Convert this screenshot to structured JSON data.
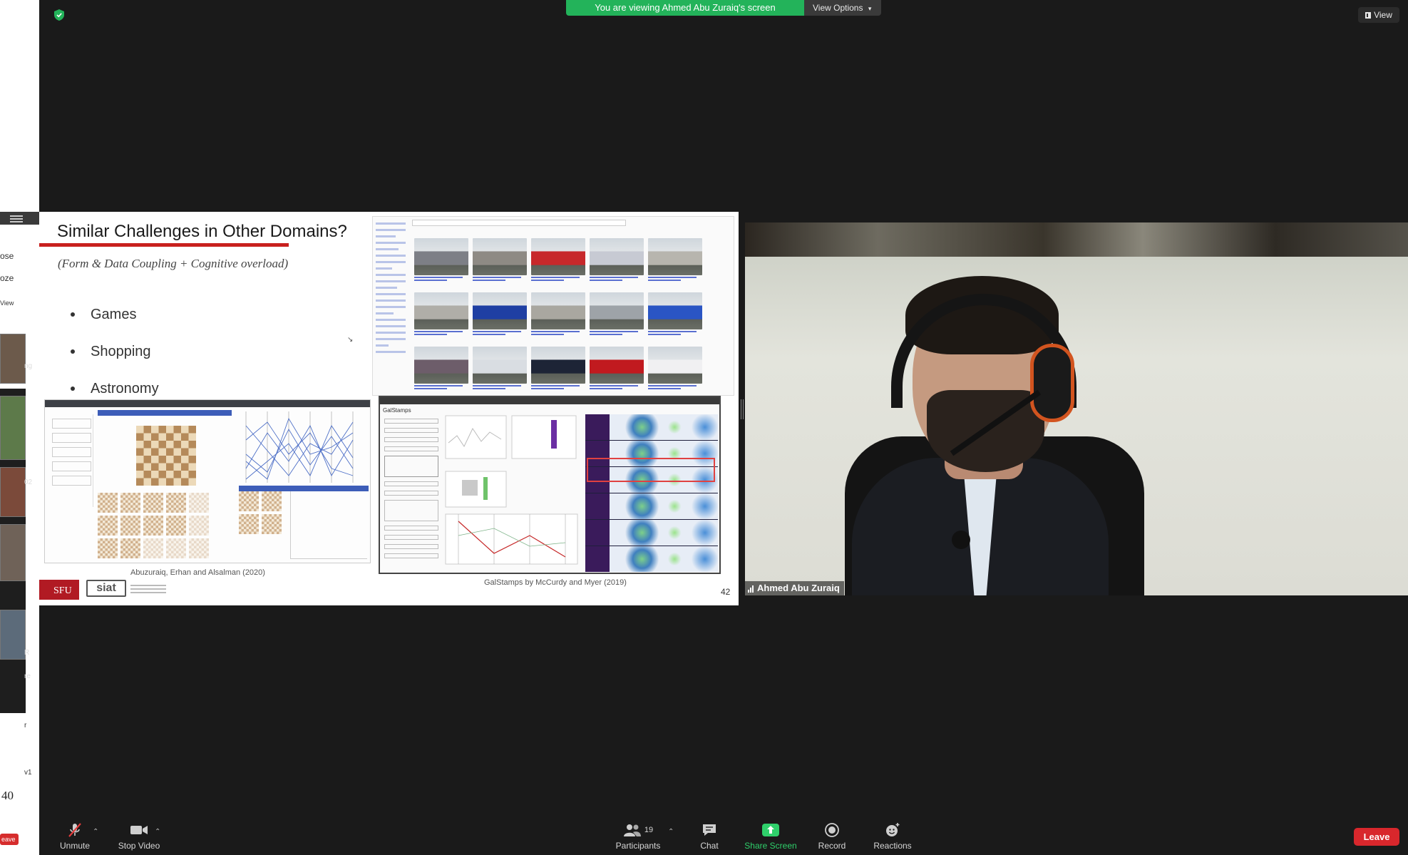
{
  "window": {
    "banner_text": "You are viewing Ahmed Abu Zuraiq's screen",
    "view_options_label": "View Options",
    "view_label": "View"
  },
  "left_strip": {
    "snippets": [
      "ose",
      "oze",
      "View",
      "ng",
      "02",
      "R",
      "re",
      "r",
      "v1"
    ],
    "page_number": "40",
    "leave_label": "eave"
  },
  "slide": {
    "title": "Similar Challenges in Other Domains?",
    "subtitle": "(Form & Data Coupling + Cognitive overload)",
    "bullets": [
      "Games",
      "Shopping",
      "Astronomy"
    ],
    "caption_left": "Abuzuraiq, Erhan and Alsalman (2020)",
    "caption_right": "GalStamps by McCurdy and Myer (2019)",
    "slide_number": "42",
    "sfu_logo": "SFU",
    "siat_logo": "siat",
    "gal_title": "GalStamps",
    "car_colors": [
      "#7d7f86",
      "#8e8a84",
      "#c7282b",
      "#c7cad3",
      "#b7b5ae",
      "#b0aea8",
      "#1f3fa3",
      "#a9a7a0",
      "#9ea3a8",
      "#2a55c4",
      "#6d5d6a",
      "#d9dde2",
      "#1d2436",
      "#c11a1f",
      "#f0f0f2"
    ]
  },
  "participant": {
    "name": "Ahmed Abu Zuraiq"
  },
  "toolbar": {
    "unmute_label": "Unmute",
    "stop_video_label": "Stop Video",
    "participants_label": "Participants",
    "participants_count": "19",
    "chat_label": "Chat",
    "share_screen_label": "Share Screen",
    "record_label": "Record",
    "reactions_label": "Reactions",
    "leave_label": "Leave"
  },
  "colors": {
    "banner_green": "#23b35a",
    "leave_red": "#d8272c",
    "share_green": "#2fd06b",
    "slide_accent": "#c8201e"
  }
}
